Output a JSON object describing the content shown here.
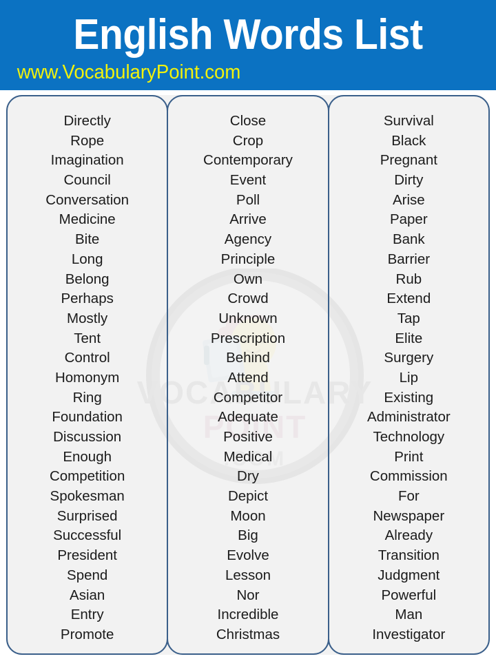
{
  "header": {
    "title": "English Words List",
    "subtitle": "www.VocabularyPoint.com",
    "background_color": "#0b72c2",
    "title_color": "#ffffff",
    "subtitle_color": "#f2f20c"
  },
  "watermark": {
    "line1": "VOCABULARY",
    "line2": "POINT",
    "line3": ".COM",
    "color": "#d6d6d6"
  },
  "card_style": {
    "border_color": "#3a5f8a",
    "background_color": "#f2f2f2",
    "text_color": "#1b1b1b"
  },
  "columns": [
    {
      "name": "column-1",
      "words": [
        "Directly",
        "Rope",
        "Imagination",
        "Council",
        "Conversation",
        "Medicine",
        "Bite",
        "Long",
        "Belong",
        "Perhaps",
        "Mostly",
        "Tent",
        "Control",
        "Homonym",
        "Ring",
        "Foundation",
        "Discussion",
        "Enough",
        "Competition",
        "Spokesman",
        "Surprised",
        "Successful",
        "President",
        "Spend",
        "Asian",
        "Entry",
        "Promote"
      ]
    },
    {
      "name": "column-2",
      "words": [
        "Close",
        "Crop",
        "Contemporary",
        "Event",
        "Poll",
        "Arrive",
        "Agency",
        "Principle",
        "Own",
        "Crowd",
        "Unknown",
        "Prescription",
        "Behind",
        "Attend",
        "Competitor",
        "Adequate",
        "Positive",
        "Medical",
        "Dry",
        "Depict",
        "Moon",
        "Big",
        "Evolve",
        "Lesson",
        "Nor",
        "Incredible",
        "Christmas"
      ]
    },
    {
      "name": "column-3",
      "words": [
        "Survival",
        "Black",
        "Pregnant",
        "Dirty",
        "Arise",
        "Paper",
        "Bank",
        "Barrier",
        "Rub",
        "Extend",
        "Tap",
        "Elite",
        "Surgery",
        "Lip",
        "Existing",
        "Administrator",
        "Technology",
        "Print",
        "Commission",
        "For",
        "Newspaper",
        "Already",
        "Transition",
        "Judgment",
        "Powerful",
        "Man",
        "Investigator"
      ]
    }
  ]
}
